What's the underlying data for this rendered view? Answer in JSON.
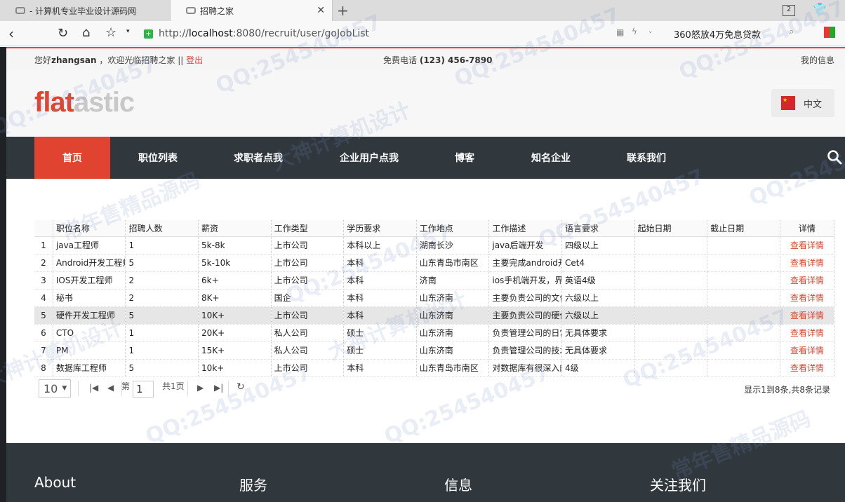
{
  "browser": {
    "tabs": [
      {
        "title": "- 计算机专业毕业设计源码网"
      },
      {
        "title": "招聘之家"
      }
    ],
    "tab_count": "2",
    "url_prefix": "http://",
    "url_host": "localhost",
    "url_rest": ":8080/recruit/user/goJobList",
    "search_ad": "360怒放4万免息贷款"
  },
  "infobar": {
    "greet_prefix": "您好",
    "username": "zhangsan",
    "greet_suffix": " ，欢迎光临招聘之家 || ",
    "logout": "登出",
    "phone_label": "免费电话 ",
    "phone": "(123) 456-7890",
    "myinfo": "我的信息"
  },
  "header": {
    "logo_a": "flat",
    "logo_b": "astic",
    "lang": "中文"
  },
  "nav": {
    "home": "首页",
    "jobs": "职位列表",
    "seeker": "求职者点我",
    "enterprise": "企业用户点我",
    "blog": "博客",
    "companies": "知名企业",
    "contact": "联系我们"
  },
  "table": {
    "headers": [
      "职位名称",
      "招聘人数",
      "薪资",
      "工作类型",
      "学历要求",
      "工作地点",
      "工作描述",
      "语言要求",
      "起始日期",
      "截止日期",
      "详情"
    ],
    "rows": [
      {
        "n": "1",
        "c": [
          "java工程师",
          "1",
          "5k-8k",
          "上市公司",
          "本科以上",
          "湖南长沙",
          "java后端开发",
          "四级以上",
          "",
          ""
        ],
        "d": "查看详情"
      },
      {
        "n": "2",
        "c": [
          "Android开发工程师",
          "5",
          "5k-10k",
          "上市公司",
          "本科",
          "山东青岛市南区",
          "主要完成android开发",
          "Cet4",
          "",
          ""
        ],
        "d": "查看详情"
      },
      {
        "n": "3",
        "c": [
          "IOS开发工程师",
          "2",
          "6k+",
          "上市公司",
          "本科",
          "济南",
          "ios手机端开发，界面",
          "英语4级",
          "",
          ""
        ],
        "d": "查看详情"
      },
      {
        "n": "4",
        "c": [
          "秘书",
          "2",
          "8K+",
          "国企",
          "本科",
          "山东济南",
          "主要负责公司的文件",
          "六级以上",
          "",
          ""
        ],
        "d": "查看详情"
      },
      {
        "n": "5",
        "c": [
          "硬件开发工程师",
          "5",
          "10K+",
          "上市公司",
          "本科",
          "山东济南",
          "主要负责公司的硬件",
          "六级以上",
          "",
          ""
        ],
        "d": "查看详情"
      },
      {
        "n": "6",
        "c": [
          "CTO",
          "1",
          "20K+",
          "私人公司",
          "硕士",
          "山东济南",
          "负责管理公司的日常",
          "无具体要求",
          "",
          ""
        ],
        "d": "查看详情"
      },
      {
        "n": "7",
        "c": [
          "PM",
          "1",
          "15K+",
          "私人公司",
          "硕士",
          "山东济南",
          "负责管理公司的技术",
          "无具体要求",
          "",
          ""
        ],
        "d": "查看详情"
      },
      {
        "n": "8",
        "c": [
          "数据库工程师",
          "5",
          "10k+",
          "上市公司",
          "本科",
          "山东青岛市南区",
          "对数据库有很深入的",
          "4级",
          "",
          ""
        ],
        "d": "查看详情"
      }
    ],
    "highlight_row": 4
  },
  "pager": {
    "page_size": "10",
    "page_label": "第",
    "page_value": "1",
    "total_pages": "共1页",
    "summary": "显示1到8条,共8条记录"
  },
  "footer": {
    "about": "About",
    "service": "服务",
    "info": "信息",
    "follow": "关注我们"
  },
  "watermarks": [
    "QQ:254540457",
    "常年售精品源码",
    "大神计算机设计"
  ],
  "colors": {
    "accent": "#e04430",
    "nav_bg": "#30373d",
    "link": "#d6462f"
  }
}
